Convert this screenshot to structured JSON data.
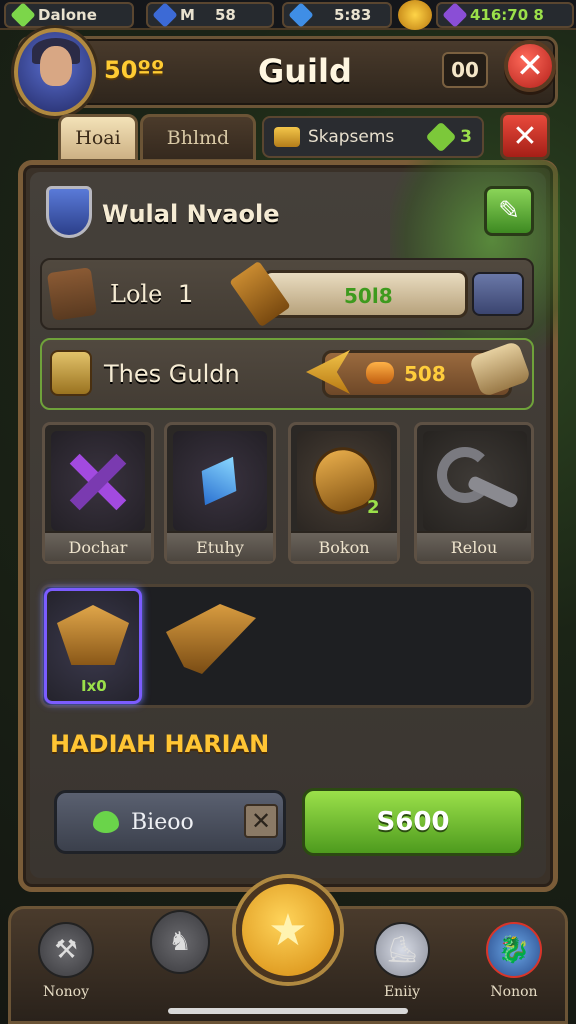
{
  "status_bar": {
    "player_name": "Dalone",
    "stat_1_label": "M",
    "stat_1_value": "58",
    "stat_2_value": "5:83",
    "stat_3_value": "416:70 8"
  },
  "header": {
    "title": "Guild",
    "coins": "50ºº",
    "counter": "00",
    "close_symbol": "✕"
  },
  "tabs": [
    {
      "label": "Hoai",
      "active": true
    },
    {
      "label": "Bhlmd",
      "active": false
    }
  ],
  "shop_tab": {
    "label": "Skapsems",
    "count": "3"
  },
  "panel": {
    "guild_name": "Wulal Nvaole",
    "role_label": "Lole",
    "role_level": "1",
    "role_bar_value": "50l8",
    "guild_row_label": "Thes Guldn",
    "guild_bar_value": "508"
  },
  "items": [
    {
      "label": "Dochar"
    },
    {
      "label": "Etuhy"
    },
    {
      "label": "Bokon",
      "badge": "2"
    },
    {
      "label": "Relou"
    }
  ],
  "slots": [
    {
      "label": "Ix0"
    }
  ],
  "daily": {
    "title": "HADIAH HARIAN",
    "grey_button": "Bieoo",
    "green_button": "S600"
  },
  "nav": [
    {
      "label": "Nonoy",
      "icon": "anvil-icon"
    },
    {
      "label": "",
      "icon": "knight-icon"
    },
    {
      "label": "",
      "icon": "center-star-icon"
    },
    {
      "label": "Eniiy",
      "icon": "boot-icon"
    },
    {
      "label": "Nonon",
      "icon": "dragon-icon"
    }
  ],
  "colors": {
    "accent_gold": "#ffc534",
    "accent_green": "#7cc83a",
    "close_red": "#d7352a"
  }
}
